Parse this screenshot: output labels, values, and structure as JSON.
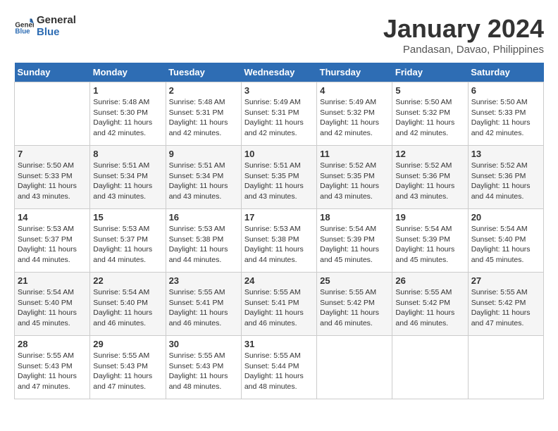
{
  "header": {
    "logo_line1": "General",
    "logo_line2": "Blue",
    "month_year": "January 2024",
    "location": "Pandasan, Davao, Philippines"
  },
  "days_of_week": [
    "Sunday",
    "Monday",
    "Tuesday",
    "Wednesday",
    "Thursday",
    "Friday",
    "Saturday"
  ],
  "weeks": [
    [
      {
        "day": "",
        "info": ""
      },
      {
        "day": "1",
        "info": "Sunrise: 5:48 AM\nSunset: 5:30 PM\nDaylight: 11 hours\nand 42 minutes."
      },
      {
        "day": "2",
        "info": "Sunrise: 5:48 AM\nSunset: 5:31 PM\nDaylight: 11 hours\nand 42 minutes."
      },
      {
        "day": "3",
        "info": "Sunrise: 5:49 AM\nSunset: 5:31 PM\nDaylight: 11 hours\nand 42 minutes."
      },
      {
        "day": "4",
        "info": "Sunrise: 5:49 AM\nSunset: 5:32 PM\nDaylight: 11 hours\nand 42 minutes."
      },
      {
        "day": "5",
        "info": "Sunrise: 5:50 AM\nSunset: 5:32 PM\nDaylight: 11 hours\nand 42 minutes."
      },
      {
        "day": "6",
        "info": "Sunrise: 5:50 AM\nSunset: 5:33 PM\nDaylight: 11 hours\nand 42 minutes."
      }
    ],
    [
      {
        "day": "7",
        "info": "Sunrise: 5:50 AM\nSunset: 5:33 PM\nDaylight: 11 hours\nand 43 minutes."
      },
      {
        "day": "8",
        "info": "Sunrise: 5:51 AM\nSunset: 5:34 PM\nDaylight: 11 hours\nand 43 minutes."
      },
      {
        "day": "9",
        "info": "Sunrise: 5:51 AM\nSunset: 5:34 PM\nDaylight: 11 hours\nand 43 minutes."
      },
      {
        "day": "10",
        "info": "Sunrise: 5:51 AM\nSunset: 5:35 PM\nDaylight: 11 hours\nand 43 minutes."
      },
      {
        "day": "11",
        "info": "Sunrise: 5:52 AM\nSunset: 5:35 PM\nDaylight: 11 hours\nand 43 minutes."
      },
      {
        "day": "12",
        "info": "Sunrise: 5:52 AM\nSunset: 5:36 PM\nDaylight: 11 hours\nand 43 minutes."
      },
      {
        "day": "13",
        "info": "Sunrise: 5:52 AM\nSunset: 5:36 PM\nDaylight: 11 hours\nand 44 minutes."
      }
    ],
    [
      {
        "day": "14",
        "info": "Sunrise: 5:53 AM\nSunset: 5:37 PM\nDaylight: 11 hours\nand 44 minutes."
      },
      {
        "day": "15",
        "info": "Sunrise: 5:53 AM\nSunset: 5:37 PM\nDaylight: 11 hours\nand 44 minutes."
      },
      {
        "day": "16",
        "info": "Sunrise: 5:53 AM\nSunset: 5:38 PM\nDaylight: 11 hours\nand 44 minutes."
      },
      {
        "day": "17",
        "info": "Sunrise: 5:53 AM\nSunset: 5:38 PM\nDaylight: 11 hours\nand 44 minutes."
      },
      {
        "day": "18",
        "info": "Sunrise: 5:54 AM\nSunset: 5:39 PM\nDaylight: 11 hours\nand 45 minutes."
      },
      {
        "day": "19",
        "info": "Sunrise: 5:54 AM\nSunset: 5:39 PM\nDaylight: 11 hours\nand 45 minutes."
      },
      {
        "day": "20",
        "info": "Sunrise: 5:54 AM\nSunset: 5:40 PM\nDaylight: 11 hours\nand 45 minutes."
      }
    ],
    [
      {
        "day": "21",
        "info": "Sunrise: 5:54 AM\nSunset: 5:40 PM\nDaylight: 11 hours\nand 45 minutes."
      },
      {
        "day": "22",
        "info": "Sunrise: 5:54 AM\nSunset: 5:40 PM\nDaylight: 11 hours\nand 46 minutes."
      },
      {
        "day": "23",
        "info": "Sunrise: 5:55 AM\nSunset: 5:41 PM\nDaylight: 11 hours\nand 46 minutes."
      },
      {
        "day": "24",
        "info": "Sunrise: 5:55 AM\nSunset: 5:41 PM\nDaylight: 11 hours\nand 46 minutes."
      },
      {
        "day": "25",
        "info": "Sunrise: 5:55 AM\nSunset: 5:42 PM\nDaylight: 11 hours\nand 46 minutes."
      },
      {
        "day": "26",
        "info": "Sunrise: 5:55 AM\nSunset: 5:42 PM\nDaylight: 11 hours\nand 46 minutes."
      },
      {
        "day": "27",
        "info": "Sunrise: 5:55 AM\nSunset: 5:42 PM\nDaylight: 11 hours\nand 47 minutes."
      }
    ],
    [
      {
        "day": "28",
        "info": "Sunrise: 5:55 AM\nSunset: 5:43 PM\nDaylight: 11 hours\nand 47 minutes."
      },
      {
        "day": "29",
        "info": "Sunrise: 5:55 AM\nSunset: 5:43 PM\nDaylight: 11 hours\nand 47 minutes."
      },
      {
        "day": "30",
        "info": "Sunrise: 5:55 AM\nSunset: 5:43 PM\nDaylight: 11 hours\nand 48 minutes."
      },
      {
        "day": "31",
        "info": "Sunrise: 5:55 AM\nSunset: 5:44 PM\nDaylight: 11 hours\nand 48 minutes."
      },
      {
        "day": "",
        "info": ""
      },
      {
        "day": "",
        "info": ""
      },
      {
        "day": "",
        "info": ""
      }
    ]
  ]
}
